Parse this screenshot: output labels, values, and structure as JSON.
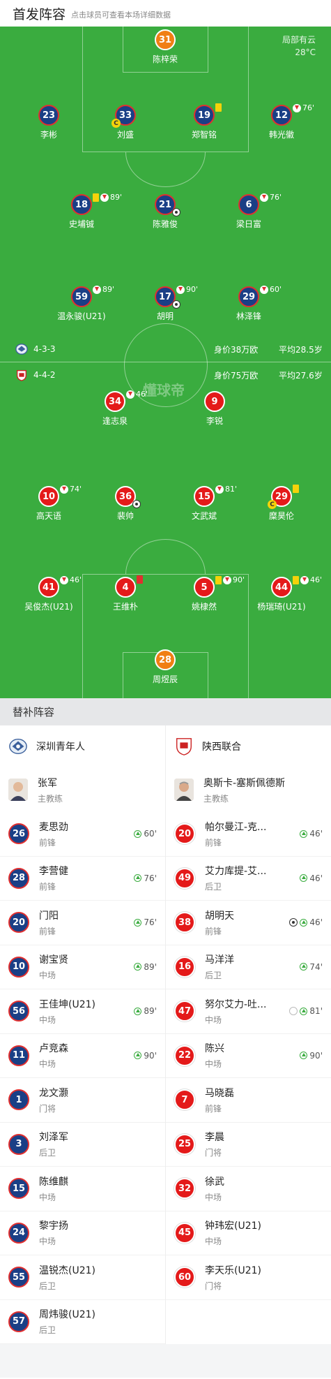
{
  "header": {
    "title": "首发阵容",
    "subtitle": "点击球员可查看本场详细数据"
  },
  "weather": {
    "desc": "局部有云",
    "temp": "28°C"
  },
  "watermark": "懂球帝",
  "home_team": {
    "name": "深圳青年人",
    "formation": "4-3-3",
    "value": "身价38万欧",
    "age": "平均28.5岁"
  },
  "away_team": {
    "name": "陕西联合",
    "formation": "4-4-2",
    "value": "身价75万欧",
    "age": "平均27.6岁"
  },
  "home_starters": [
    {
      "num": "31",
      "name": "陈梓荣",
      "gk": true
    },
    {
      "num": "23",
      "name": "李彬"
    },
    {
      "num": "33",
      "name": "刘盛",
      "captain": true
    },
    {
      "num": "19",
      "name": "郑智铭",
      "yellow": true
    },
    {
      "num": "12",
      "name": "韩光徽",
      "subout": "76'"
    },
    {
      "num": "18",
      "name": "史埔铖",
      "yellow": true,
      "subout": "89'"
    },
    {
      "num": "21",
      "name": "陈雅俊",
      "goal": true
    },
    {
      "num": "6",
      "name": "梁日富",
      "subout": "76'"
    },
    {
      "num": "59",
      "name": "温永骏(U21)",
      "subout": "89'"
    },
    {
      "num": "17",
      "name": "胡明",
      "subout": "90'",
      "goal": true
    },
    {
      "num": "29",
      "name": "林泽锋",
      "subout": "60'"
    }
  ],
  "away_starters": [
    {
      "num": "34",
      "name": "逢志泉",
      "subout": "46'"
    },
    {
      "num": "9",
      "name": "李锐"
    },
    {
      "num": "10",
      "name": "高天语",
      "subout": "74'"
    },
    {
      "num": "36",
      "name": "裴帅",
      "goal": true
    },
    {
      "num": "15",
      "name": "文武斌",
      "subout": "81'"
    },
    {
      "num": "29",
      "name": "糜昊伦",
      "yellow": true,
      "captain": true
    },
    {
      "num": "41",
      "name": "吴俊杰(U21)",
      "subout": "46'"
    },
    {
      "num": "4",
      "name": "王维朴",
      "red": true
    },
    {
      "num": "5",
      "name": "姚棣然",
      "yellow": true,
      "subout": "90'"
    },
    {
      "num": "44",
      "name": "杨瑞琦(U21)",
      "yellow": true,
      "subout": "46'"
    },
    {
      "num": "28",
      "name": "周煜辰",
      "gk": true
    }
  ],
  "subs_header": "替补阵容",
  "home_coach": {
    "name": "张军",
    "role": "主教练"
  },
  "away_coach": {
    "name": "奥斯卡-塞斯佩德斯",
    "role": "主教练"
  },
  "home_subs": [
    {
      "num": "26",
      "name": "麦思劲",
      "pos": "前锋",
      "min": "60'"
    },
    {
      "num": "28",
      "name": "李营健",
      "pos": "前锋",
      "min": "76'"
    },
    {
      "num": "20",
      "name": "门阳",
      "pos": "前锋",
      "min": "76'"
    },
    {
      "num": "10",
      "name": "谢宝贤",
      "pos": "中场",
      "min": "89'"
    },
    {
      "num": "56",
      "name": "王佳坤(U21)",
      "pos": "中场",
      "min": "89'"
    },
    {
      "num": "11",
      "name": "卢竞森",
      "pos": "中场",
      "min": "90'"
    },
    {
      "num": "1",
      "name": "龙文灏",
      "pos": "门将",
      "min": ""
    },
    {
      "num": "3",
      "name": "刘泽军",
      "pos": "后卫",
      "min": ""
    },
    {
      "num": "15",
      "name": "陈维麒",
      "pos": "中场",
      "min": ""
    },
    {
      "num": "24",
      "name": "黎宇扬",
      "pos": "中场",
      "min": ""
    },
    {
      "num": "55",
      "name": "温锐杰(U21)",
      "pos": "后卫",
      "min": ""
    },
    {
      "num": "57",
      "name": "周炜骏(U21)",
      "pos": "后卫",
      "min": ""
    }
  ],
  "away_subs": [
    {
      "num": "20",
      "name": "帕尔曼江-克...",
      "pos": "前锋",
      "min": "46'"
    },
    {
      "num": "49",
      "name": "艾力库提-艾...",
      "pos": "后卫",
      "min": "46'"
    },
    {
      "num": "38",
      "name": "胡明天",
      "pos": "前锋",
      "min": "46'",
      "goal": true
    },
    {
      "num": "16",
      "name": "马洋洋",
      "pos": "后卫",
      "min": "74'"
    },
    {
      "num": "47",
      "name": "努尔艾力-吐...",
      "pos": "中场",
      "min": "81'",
      "assist": true
    },
    {
      "num": "22",
      "name": "陈兴",
      "pos": "中场",
      "min": "90'"
    },
    {
      "num": "7",
      "name": "马晓磊",
      "pos": "前锋",
      "min": ""
    },
    {
      "num": "25",
      "name": "李晨",
      "pos": "门将",
      "min": ""
    },
    {
      "num": "32",
      "name": "徐武",
      "pos": "中场",
      "min": ""
    },
    {
      "num": "45",
      "name": "钟玮宏(U21)",
      "pos": "中场",
      "min": ""
    },
    {
      "num": "60",
      "name": "李天乐(U21)",
      "pos": "门将",
      "min": ""
    }
  ]
}
